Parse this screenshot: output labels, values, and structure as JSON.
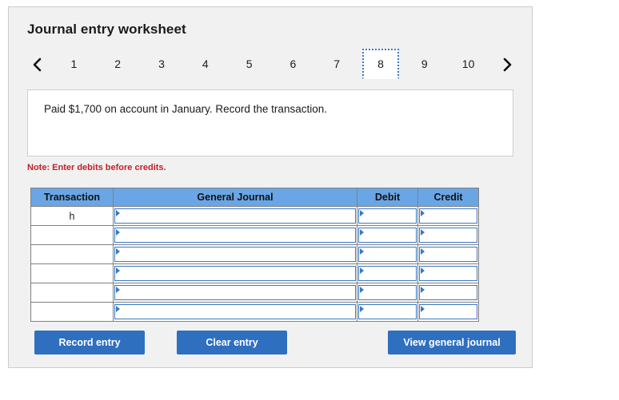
{
  "worksheet": {
    "title": "Journal entry worksheet",
    "prev_icon": "chevron-left-icon",
    "next_icon": "chevron-right-icon",
    "tabs": [
      {
        "label": "1",
        "active": false
      },
      {
        "label": "2",
        "active": false
      },
      {
        "label": "3",
        "active": false
      },
      {
        "label": "4",
        "active": false
      },
      {
        "label": "5",
        "active": false
      },
      {
        "label": "6",
        "active": false
      },
      {
        "label": "7",
        "active": false
      },
      {
        "label": "8",
        "active": true
      },
      {
        "label": "9",
        "active": false
      },
      {
        "label": "10",
        "active": false
      }
    ],
    "question": "Paid $1,700 on account in January. Record the transaction.",
    "note": "Note: Enter debits before credits."
  },
  "table": {
    "headers": [
      "Transaction",
      "General Journal",
      "Debit",
      "Credit"
    ],
    "rows": [
      {
        "transaction": "h",
        "general_journal": "",
        "debit": "",
        "credit": ""
      },
      {
        "transaction": "",
        "general_journal": "",
        "debit": "",
        "credit": ""
      },
      {
        "transaction": "",
        "general_journal": "",
        "debit": "",
        "credit": ""
      },
      {
        "transaction": "",
        "general_journal": "",
        "debit": "",
        "credit": ""
      },
      {
        "transaction": "",
        "general_journal": "",
        "debit": "",
        "credit": ""
      },
      {
        "transaction": "",
        "general_journal": "",
        "debit": "",
        "credit": ""
      }
    ]
  },
  "buttons": {
    "record": "Record entry",
    "clear": "Clear entry",
    "view": "View general journal"
  },
  "colors": {
    "button_blue": "#2f6fc0",
    "header_blue": "#6aa6e5",
    "input_border_blue": "#3a78c0",
    "note_red": "#c32027",
    "card_bg": "#f1f1f1"
  }
}
